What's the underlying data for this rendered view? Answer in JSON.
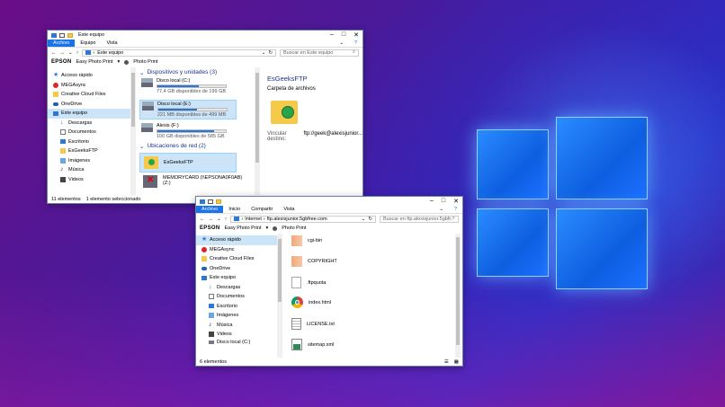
{
  "win1": {
    "title": "Este equipo",
    "menu": [
      "Archivo",
      "Equipo",
      "Vista"
    ],
    "address": "Este equipo",
    "search_placeholder": "Buscar en Este equipo",
    "epson": {
      "brand": "EPSON",
      "item1": "Easy Photo Print",
      "item2": "Photo Print"
    },
    "nav": [
      {
        "label": "Acceso rápido",
        "icon": "star-icon"
      },
      {
        "label": "MEGAsync",
        "icon": "mega-icon"
      },
      {
        "label": "Creative Cloud Files",
        "icon": "folder-icon"
      },
      {
        "label": "OneDrive",
        "icon": "cloud-icon"
      },
      {
        "label": "Este equipo",
        "icon": "computer-icon"
      },
      {
        "label": "Descargas",
        "icon": "download-icon"
      },
      {
        "label": "Documentos",
        "icon": "document-icon"
      },
      {
        "label": "Escritorio",
        "icon": "desktop-icon"
      },
      {
        "label": "EsGeeksFTP",
        "icon": "network-folder-icon"
      },
      {
        "label": "Imágenes",
        "icon": "image-icon"
      },
      {
        "label": "Música",
        "icon": "music-icon"
      },
      {
        "label": "Videos",
        "icon": "video-icon"
      }
    ],
    "group_devices": "Dispositivos y unidades (3)",
    "drives": [
      {
        "name": "Disco local (C:)",
        "free": "77,4 GB disponibles de 199 GB",
        "used_fraction": 0.61
      },
      {
        "name": "Disco local (E:)",
        "free": "221 MB disponibles de 499 MB",
        "used_fraction": 0.56
      },
      {
        "name": "Alexis (F:)",
        "free": "100 GB disponibles de 585 GB",
        "used_fraction": 0.83
      }
    ],
    "group_network": "Ubicaciones de red (2)",
    "network": [
      {
        "name": "EsGeeksFTP"
      },
      {
        "name": "MEMORYCARD (\\\\EPSONA0F0AB)",
        "sub": "(Z:)"
      }
    ],
    "details": {
      "title": "EsGeeksFTP",
      "subtitle": "Carpeta de archivos",
      "link_label": "Vincular destino:",
      "link_value": "ftp://geek@alexisjunior..."
    },
    "status": {
      "count": "11 elementos",
      "selected": "1 elemento seleccionado"
    }
  },
  "win2": {
    "menu": [
      "Archivo",
      "Inicio",
      "Compartir",
      "Vista"
    ],
    "address_parts": [
      "Internet",
      "ftp.alexisjunior.5gbfree.com"
    ],
    "search_placeholder": "Buscar en ftp.alexisjunior.5gbfr...",
    "epson": {
      "brand": "EPSON",
      "item1": "Easy Photo Print",
      "item2": "Photo Print"
    },
    "nav": [
      {
        "label": "Acceso rápido",
        "icon": "star-icon"
      },
      {
        "label": "MEGAsync",
        "icon": "mega-icon"
      },
      {
        "label": "Creative Cloud Files",
        "icon": "folder-icon"
      },
      {
        "label": "OneDrive",
        "icon": "cloud-icon"
      },
      {
        "label": "Este equipo",
        "icon": "computer-icon"
      },
      {
        "label": "Descargas",
        "icon": "download-icon"
      },
      {
        "label": "Documentos",
        "icon": "document-icon"
      },
      {
        "label": "Escritorio",
        "icon": "desktop-icon"
      },
      {
        "label": "Imágenes",
        "icon": "image-icon"
      },
      {
        "label": "Música",
        "icon": "music-icon"
      },
      {
        "label": "Videos",
        "icon": "video-icon"
      },
      {
        "label": "Disco local (C:)",
        "icon": "drive-icon"
      }
    ],
    "files": [
      {
        "name": "cgi-bin",
        "icon": "folder-icon"
      },
      {
        "name": "COPYRIGHT",
        "icon": "folder-icon"
      },
      {
        "name": ".ftpquota",
        "icon": "file-icon"
      },
      {
        "name": "index.html",
        "icon": "chrome-icon"
      },
      {
        "name": "LICENSE.txt",
        "icon": "text-file-icon"
      },
      {
        "name": "sitemap.xml",
        "icon": "xml-file-icon"
      }
    ],
    "status": {
      "count": "6 elementos"
    }
  },
  "colors": {
    "accent": "#1a73e8",
    "selected": "#cce4f7",
    "drive_bar": "#2677d9"
  }
}
